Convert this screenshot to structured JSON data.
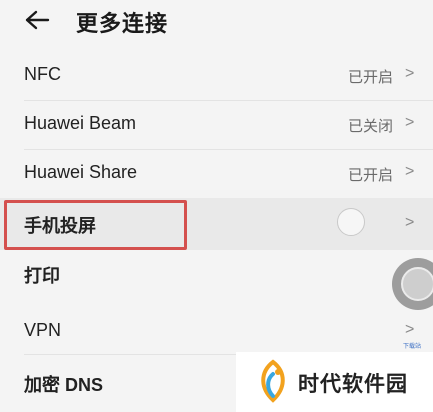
{
  "header": {
    "title": "更多连接"
  },
  "rows": [
    {
      "label": "NFC",
      "status": "已开启"
    },
    {
      "label": "Huawei Beam",
      "status": "已关闭"
    },
    {
      "label": "Huawei Share",
      "status": "已开启"
    },
    {
      "label": "手机投屏",
      "status": ""
    },
    {
      "label": "打印",
      "status": ""
    },
    {
      "label": "VPN",
      "status": ""
    },
    {
      "label": "加密 DNS",
      "status": ""
    }
  ],
  "chevron_glyph": ">",
  "corner_label": "下载站",
  "watermark": {
    "text": "时代软件园"
  },
  "colors": {
    "highlight_box": "#d4504e",
    "background": "#f4f4f4"
  }
}
